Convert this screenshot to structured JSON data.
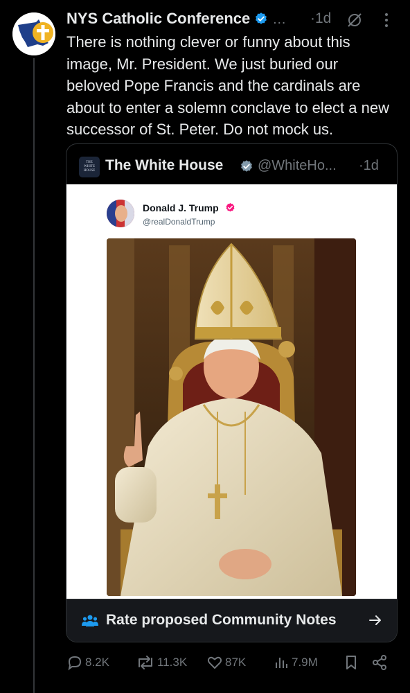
{
  "post": {
    "author_name": "NYS Catholic Conference",
    "ellipsis": "…",
    "time": "·1d",
    "text": "There is nothing clever or funny about this image, Mr. President. We just buried our beloved Pope Francis and the cardinals are about to enter a solemn conclave to elect a new successor of St. Peter. Do not mock us."
  },
  "quote": {
    "avatar_lines": [
      "THE",
      "WHITE",
      "HOUSE"
    ],
    "name": "The White House",
    "handle": "@WhiteHo...",
    "time": "·1d",
    "inner_post": {
      "name": "Donald J. Trump",
      "handle": "@realDonaldTrump"
    }
  },
  "community_notes": {
    "label": "Rate proposed Community Notes"
  },
  "actions": {
    "replies": "8.2K",
    "reposts": "11.3K",
    "likes": "87K",
    "views": "7.9M"
  },
  "colors": {
    "background": "#000000",
    "text": "#e7e9ea",
    "muted": "#71767b",
    "verified": "#1d9bf0",
    "border": "#2f3336"
  },
  "icons": [
    "verified-badge-icon",
    "grok-icon",
    "more-icon",
    "people-icon",
    "arrow-right-icon",
    "reply-icon",
    "repost-icon",
    "like-icon",
    "views-icon",
    "bookmark-icon",
    "share-icon"
  ]
}
